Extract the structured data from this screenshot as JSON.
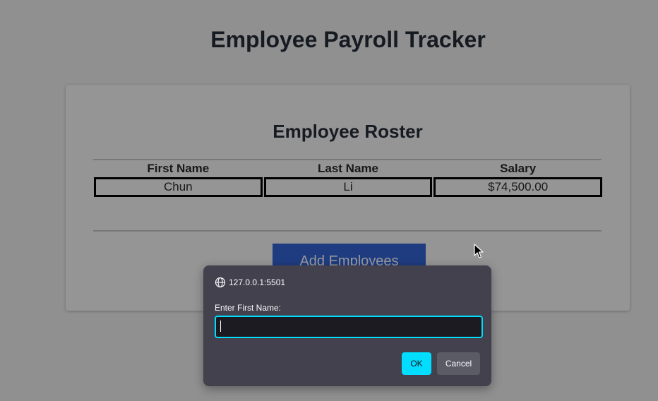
{
  "page": {
    "title": "Employee Payroll Tracker"
  },
  "roster": {
    "title": "Employee Roster",
    "columns": [
      "First Name",
      "Last Name",
      "Salary"
    ],
    "rows": [
      [
        "Chun",
        "Li",
        "$74,500.00"
      ]
    ],
    "add_button_label": "Add Employees"
  },
  "prompt_dialog": {
    "origin": "127.0.0.1:5501",
    "origin_icon": "globe-icon",
    "label": "Enter First Name:",
    "input_value": "",
    "ok_label": "OK",
    "cancel_label": "Cancel"
  },
  "colors": {
    "accent": "#00ddff",
    "add_button": "#3565d8",
    "dialog_bg": "#42414d"
  }
}
